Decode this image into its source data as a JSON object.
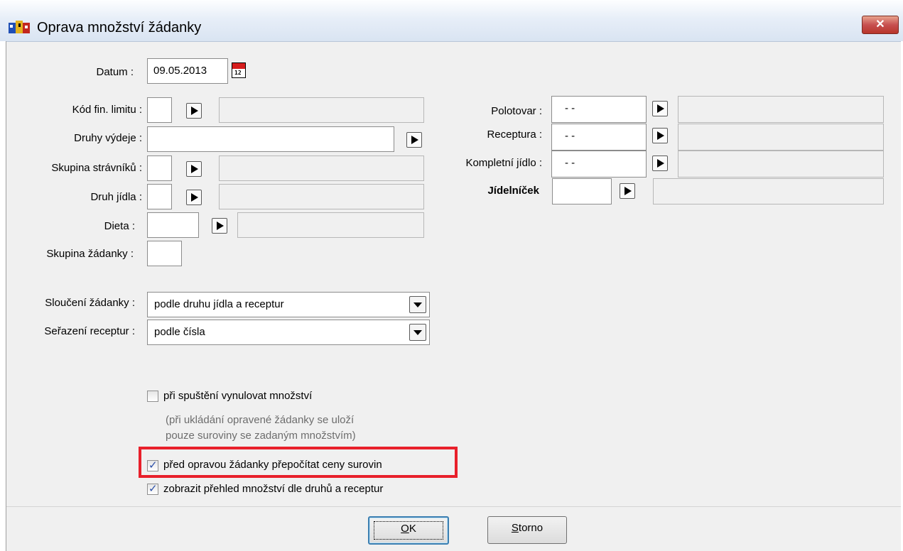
{
  "window": {
    "title": "Oprava množství žádanky",
    "close_label": "✕"
  },
  "form": {
    "datum": {
      "label": "Datum :",
      "value": "09.05.2013"
    },
    "kod_fin_limitu": {
      "label": "Kód fin. limitu :",
      "value": "",
      "name_value": ""
    },
    "druhy_vydeje": {
      "label": "Druhy výdeje :",
      "value": ""
    },
    "skupina_stravniku": {
      "label": "Skupina strávníků :",
      "value": "",
      "name_value": ""
    },
    "druh_jidla": {
      "label": "Druh jídla :",
      "value": "",
      "name_value": ""
    },
    "dieta": {
      "label": "Dieta :",
      "value": "",
      "name_value": ""
    },
    "skupina_zadanky": {
      "label": "Skupina žádanky :",
      "value": ""
    },
    "polotovar": {
      "label": "Polotovar :",
      "value": "- -",
      "name_value": ""
    },
    "receptura": {
      "label": "Receptura :",
      "value": "- -",
      "name_value": ""
    },
    "kompletni_jidlo": {
      "label": "Kompletní jídlo :",
      "value": "- -",
      "name_value": ""
    },
    "jidelnicek": {
      "label": "Jídelníček",
      "value": "",
      "name_value": ""
    },
    "slouceni": {
      "label": "Sloučení žádanky :",
      "selected": "podle druhu jídla a receptur"
    },
    "serazeni": {
      "label": "Seřazení receptur :",
      "selected": "podle čísla"
    }
  },
  "options": {
    "vynulovat": {
      "label": "při spuštění vynulovat množství",
      "checked": false
    },
    "note_line1": "(při ukládání opravené žádanky se uloží",
    "note_line2": "pouze suroviny se zadaným množstvím)",
    "prepocitat": {
      "label": "před opravou žádanky přepočítat ceny surovin",
      "checked": true
    },
    "zobrazit": {
      "label": "zobrazit přehled množství dle druhů a receptur",
      "checked": true
    }
  },
  "buttons": {
    "ok_mnemonic": "O",
    "ok_rest": "K",
    "storno_mnemonic": "S",
    "storno_rest": "torno"
  },
  "colors": {
    "highlight": "#e8202b",
    "close_button": "#c75050",
    "checkmark": "#2b4fa8"
  }
}
